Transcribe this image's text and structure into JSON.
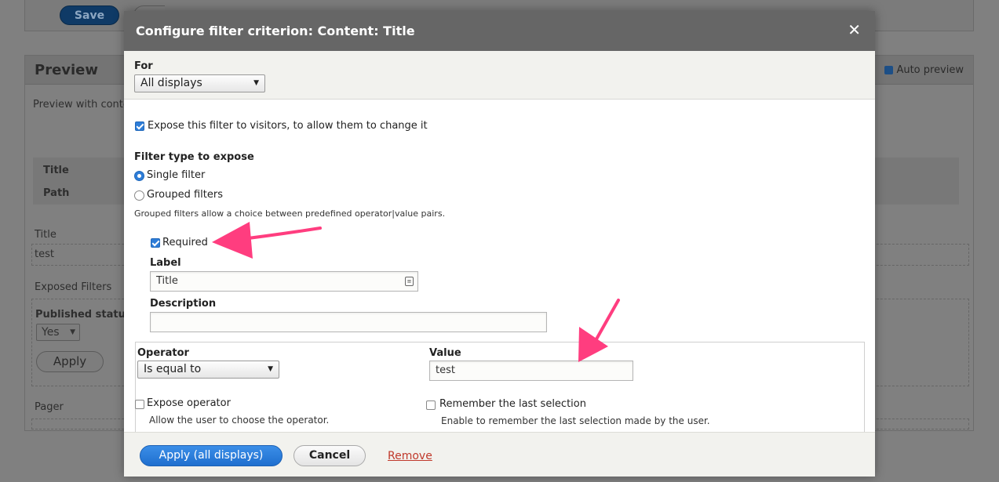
{
  "background": {
    "save_label": "Save",
    "preview_title": "Preview",
    "auto_preview_label": "Auto preview",
    "preview_with_text": "Preview with conte",
    "row_title": "Title",
    "row_path": "Path",
    "field_title_label": "Title",
    "field_title_value": "test",
    "exposed_filters_label": "Exposed Filters",
    "published_status_label": "Published status",
    "published_select_value": "Yes",
    "apply_label": "Apply",
    "pager_label": "Pager"
  },
  "modal": {
    "title": "Configure filter criterion: Content: Title",
    "close_glyph": "✕",
    "for_label": "For",
    "for_select_value": "All displays",
    "expose_label": "Expose this filter to visitors, to allow them to change it",
    "filter_type_heading": "Filter type to expose",
    "single_filter_label": "Single filter",
    "grouped_filters_label": "Grouped filters",
    "grouped_help": "Grouped filters allow a choice between predefined operator|value pairs.",
    "required_label": "Required",
    "label_heading": "Label",
    "label_value": "Title",
    "description_heading": "Description",
    "description_value": "",
    "operator_heading": "Operator",
    "operator_value": "Is equal to",
    "value_heading": "Value",
    "value_value": "test",
    "expose_operator_label": "Expose operator",
    "expose_operator_help": "Allow the user to choose the operator.",
    "remember_label": "Remember the last selection",
    "remember_help": "Enable to remember the last selection made by the user.",
    "apply_all_label": "Apply (all displays)",
    "cancel_label": "Cancel",
    "remove_label": "Remove"
  },
  "colors": {
    "accent": "#2e7dd8",
    "title_bar": "#666666",
    "annotation_arrow": "#ff3d7f",
    "remove_link": "#c0392b"
  }
}
